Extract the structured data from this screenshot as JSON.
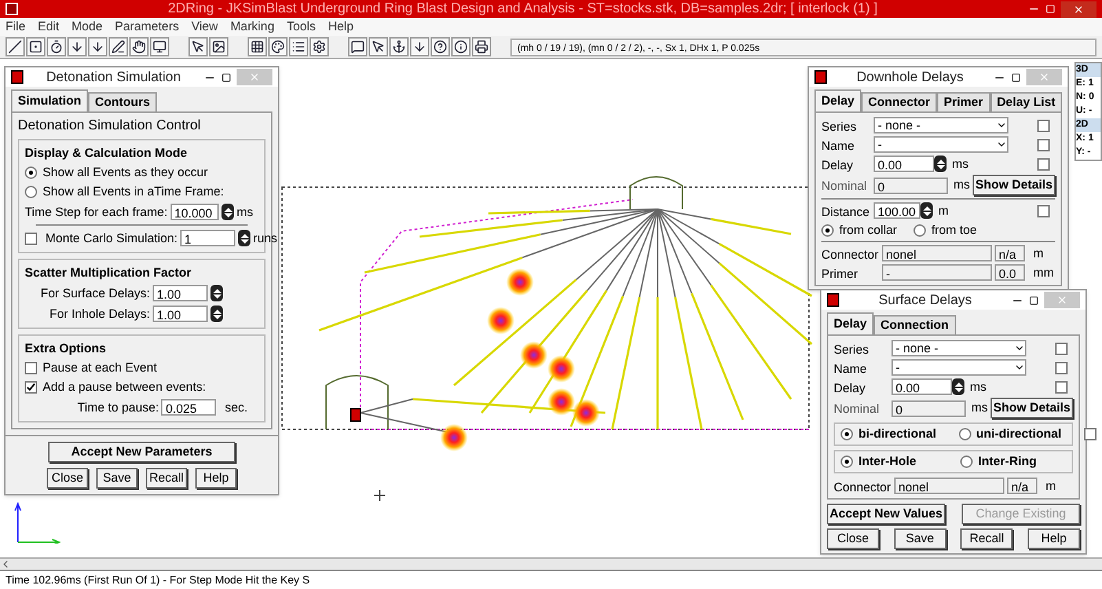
{
  "window": {
    "title": "2DRing - JKSimBlast Underground Ring Blast Design and Analysis - ST=stocks.stk, DB=samples.2dr; [ interlock (1) ]"
  },
  "menu": [
    "File",
    "Edit",
    "Mode",
    "Parameters",
    "View",
    "Marking",
    "Tools",
    "Help"
  ],
  "toolbar": {
    "status": "(mh 0 / 19 / 19), (mn 0 / 2 / 2), -, -, Sx 1, DHx 1, P 0.025s"
  },
  "side_panel": [
    {
      "text": "3D",
      "kind": "header"
    },
    {
      "text": "E: 1",
      "kind": "value"
    },
    {
      "text": "N: 0",
      "kind": "value"
    },
    {
      "text": "U: -",
      "kind": "value"
    },
    {
      "text": "2D",
      "kind": "header"
    },
    {
      "text": "X: 1",
      "kind": "value"
    },
    {
      "text": "Y: -",
      "kind": "value"
    }
  ],
  "detonation": {
    "title": "Detonation Simulation",
    "tabs": [
      {
        "label": "Simulation",
        "selected": true
      },
      {
        "label": "Contours",
        "selected": false
      }
    ],
    "group": "Detonation Simulation Control",
    "mode": {
      "title": "Display & Calculation  Mode",
      "options": [
        {
          "label": "Show all Events as they occur",
          "selected": true
        },
        {
          "label": "Show all Events in aTime Frame:",
          "selected": false
        }
      ],
      "time_step": {
        "label": "Time Step for each frame:",
        "value": "10.000",
        "unit": "ms"
      },
      "monte_carlo": {
        "label": "Monte Carlo Simulation:",
        "checked": false,
        "value": "1",
        "unit": "runs"
      }
    },
    "scatter": {
      "title": "Scatter Multiplication Factor",
      "fields": [
        {
          "label": "For Surface Delays:",
          "value": "1.00"
        },
        {
          "label": "For Inhole Delays:",
          "value": "1.00"
        }
      ]
    },
    "extra": {
      "title": "Extra Options",
      "checks": [
        {
          "label": "Pause at each Event",
          "checked": false
        },
        {
          "label": "Add a pause between events:",
          "checked": true
        }
      ],
      "pause": {
        "label": "Time to pause:",
        "value": "0.025",
        "unit": "sec."
      }
    },
    "accept": "Accept New Parameters",
    "buttons": [
      "Close",
      "Save",
      "Recall",
      "Help"
    ]
  },
  "downhole": {
    "title": "Downhole Delays",
    "tabs": [
      {
        "label": "Delay",
        "selected": true
      },
      {
        "label": "Connector",
        "selected": false
      },
      {
        "label": "Primer",
        "selected": false
      },
      {
        "label": "Delay List",
        "selected": false
      }
    ],
    "series": {
      "label": "Series",
      "value": "- none -",
      "checked": false
    },
    "name": {
      "label": "Name",
      "value": "-",
      "checked": false
    },
    "delay": {
      "label": "Delay",
      "value": "0.00",
      "unit": "ms",
      "checked": false
    },
    "nominal": {
      "label": "Nominal",
      "value": "0",
      "unit": "ms"
    },
    "details_button": "Show Details",
    "distance": {
      "label": "Distance",
      "value": "100.00",
      "unit": "m",
      "checked": false
    },
    "from": [
      {
        "label": "from collar",
        "selected": true
      },
      {
        "label": "from toe",
        "selected": false
      }
    ],
    "connector": {
      "label": "Connector",
      "value": "nonel",
      "value_2": "n/a",
      "unit": "m"
    },
    "primer": {
      "label": "Primer",
      "value": "-",
      "value_2": "0.0",
      "unit": "mm"
    }
  },
  "surface": {
    "title": "Surface Delays",
    "tabs": [
      {
        "label": "Delay",
        "selected": true
      },
      {
        "label": "Connection",
        "selected": false
      }
    ],
    "series": {
      "label": "Series",
      "value": "- none -",
      "checked": false
    },
    "name": {
      "label": "Name",
      "value": "-",
      "checked": false
    },
    "delay": {
      "label": "Delay",
      "value": "0.00",
      "unit": "ms",
      "checked": false
    },
    "nominal": {
      "label": "Nominal",
      "value": "0",
      "unit": "ms"
    },
    "details_button": "Show Details",
    "direction": {
      "options": [
        {
          "label": "bi-directional",
          "selected": true
        },
        {
          "label": "uni-directional",
          "selected": false
        }
      ],
      "checked": false
    },
    "link": {
      "options": [
        {
          "label": "Inter-Hole",
          "selected": true
        },
        {
          "label": "Inter-Ring",
          "selected": false
        }
      ]
    },
    "connector": {
      "label": "Connector",
      "value": "nonel",
      "value_2": "n/a",
      "unit": "m"
    },
    "accept": "Accept New Values",
    "change": {
      "label": "Change Existing",
      "disabled": true
    },
    "buttons": [
      "Close",
      "Save",
      "Recall",
      "Help"
    ]
  },
  "status_bar": "Time 102.96ms (First Run Of 1) - For Step Mode Hit the Key S"
}
